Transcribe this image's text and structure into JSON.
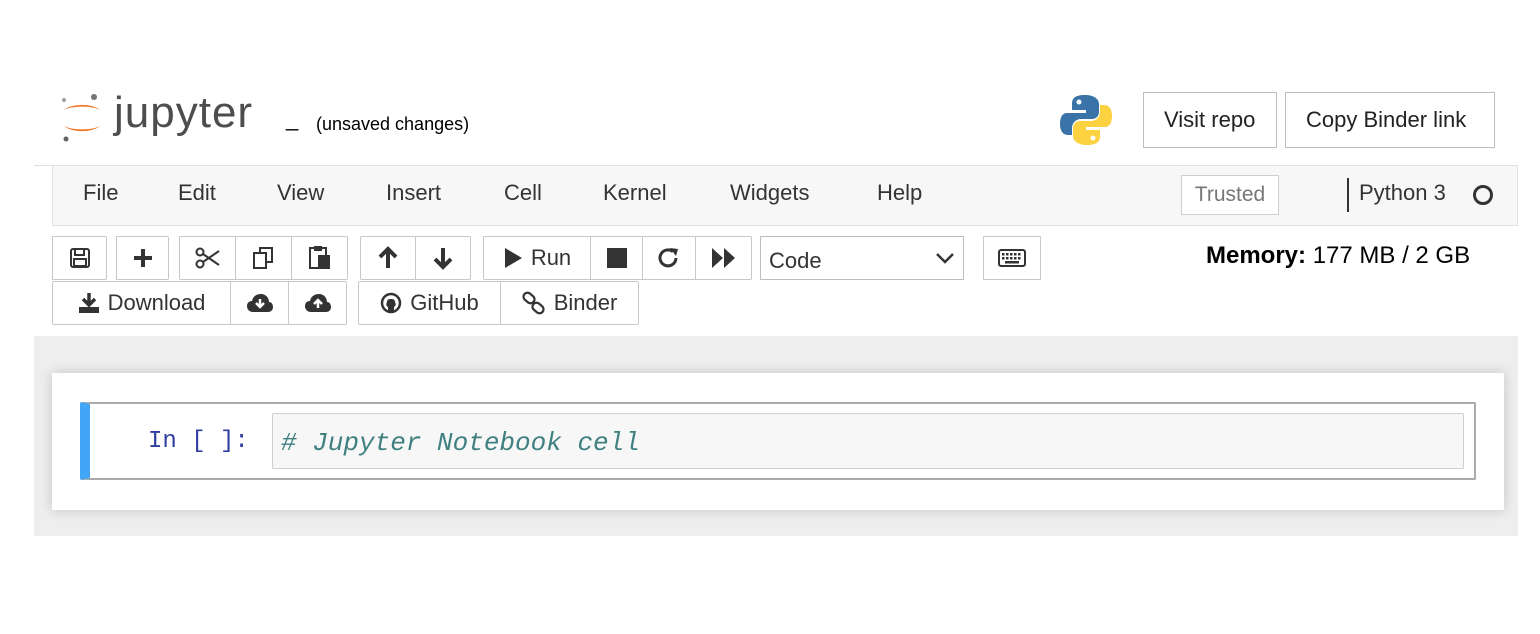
{
  "header": {
    "logo_text": "jupyter",
    "notebook_name": "_",
    "save_status": "(unsaved changes)",
    "visit_repo_label": "Visit repo",
    "copy_binder_label": "Copy Binder link",
    "logo_icon": "jupyter-logo-icon",
    "python_icon": "python-logo-icon"
  },
  "menubar": {
    "items": [
      "File",
      "Edit",
      "View",
      "Insert",
      "Cell",
      "Kernel",
      "Widgets",
      "Help"
    ],
    "trusted_label": "Trusted",
    "kernel_name": "Python 3",
    "kernel_status": "idle"
  },
  "toolbar": {
    "run_label": "Run",
    "cell_type": "Code",
    "download_label": "Download",
    "github_label": "GitHub",
    "binder_label": "Binder",
    "memory_label": "Memory:",
    "memory_value": "177 MB / 2 GB"
  },
  "notebook": {
    "cells": [
      {
        "prompt": "In [ ]:",
        "source": "# Jupyter Notebook cell"
      }
    ]
  },
  "colors": {
    "jupyter_orange": "#f37726",
    "cell_selected": "#42a5f5",
    "prompt_blue": "#303f9f",
    "comment_teal": "#408080"
  }
}
